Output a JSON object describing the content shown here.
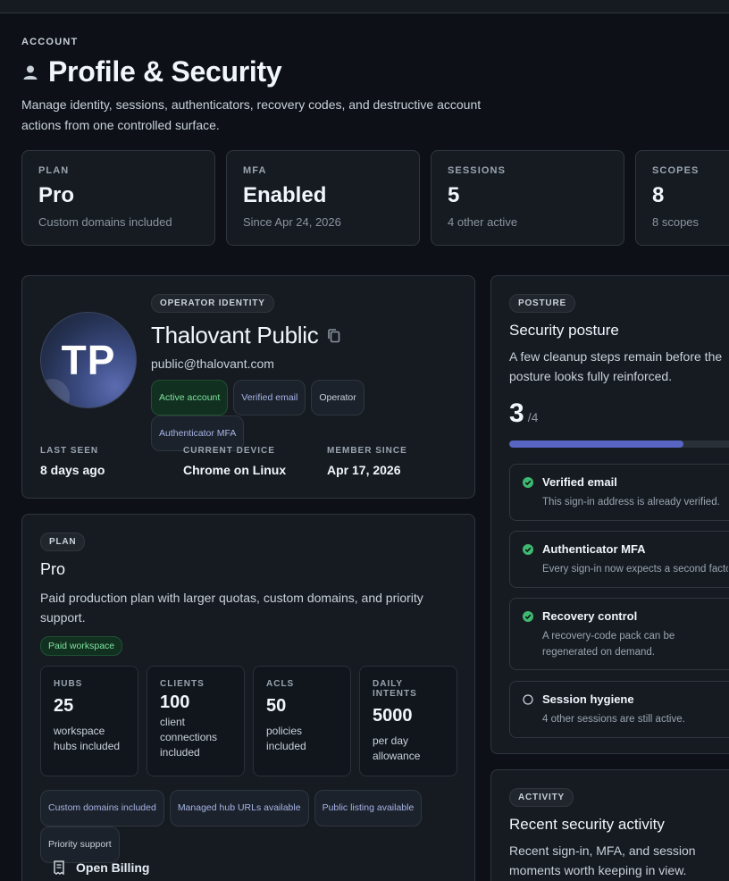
{
  "header": {
    "eyebrow": "ACCOUNT",
    "title": "Profile & Security",
    "description": "Manage identity, sessions, authenticators, recovery codes, and destructive account actions from one controlled surface."
  },
  "stats": [
    {
      "label": "PLAN",
      "value": "Pro",
      "sub": "Custom domains included"
    },
    {
      "label": "MFA",
      "value": "Enabled",
      "sub": "Since Apr 24, 2026"
    },
    {
      "label": "SESSIONS",
      "value": "5",
      "sub": "4 other active"
    },
    {
      "label": "SCOPES",
      "value": "8",
      "sub": "8 scopes"
    }
  ],
  "identity": {
    "chip": "OPERATOR IDENTITY",
    "initials": "TP",
    "name": "Thalovant Public",
    "email": "public@thalovant.com",
    "tags": [
      "Active account",
      "Verified email",
      "Operator",
      "Authenticator MFA"
    ],
    "meta": [
      {
        "label": "LAST SEEN",
        "value": "8 days ago"
      },
      {
        "label": "CURRENT DEVICE",
        "value": "Chrome on Linux"
      },
      {
        "label": "MEMBER SINCE",
        "value": "Apr 17, 2026"
      }
    ]
  },
  "plan": {
    "chip": "PLAN",
    "title": "Pro",
    "description": "Paid production plan with larger quotas, custom domains, and priority support.",
    "badge": "Paid workspace",
    "quotas": [
      {
        "label": "HUBS",
        "value": "25",
        "sub": "workspace hubs included"
      },
      {
        "label": "CLIENTS",
        "value": "100",
        "sub": "client connections included"
      },
      {
        "label": "ACLS",
        "value": "50",
        "sub": "policies included"
      },
      {
        "label": "DAILY INTENTS",
        "value": "5000",
        "sub": "per day allowance"
      }
    ],
    "features": [
      "Custom domains included",
      "Managed hub URLs available",
      "Public listing available",
      "Priority support"
    ],
    "billing_label": "Open Billing"
  },
  "posture": {
    "chip": "POSTURE",
    "title": "Security posture",
    "description": "A few cleanup steps remain before the posture looks fully reinforced.",
    "score": "3",
    "score_total": "/4",
    "progress_fraction": 0.75,
    "checks": [
      {
        "title": "Verified email",
        "desc": "This sign-in address is already verified.",
        "done": true
      },
      {
        "title": "Authenticator MFA",
        "desc": "Every sign-in now expects a second factor.",
        "done": true
      },
      {
        "title": "Recovery control",
        "desc": "A recovery-code pack can be regenerated on demand.",
        "done": true
      },
      {
        "title": "Session hygiene",
        "desc": "4 other sessions are still active.",
        "done": false
      }
    ]
  },
  "activity": {
    "chip": "ACTIVITY",
    "title": "Recent security activity",
    "description": "Recent sign-in, MFA, and session moments worth keeping in view."
  },
  "colors": {
    "background": "#0d1117",
    "card": "#161b22",
    "accent": "#5865c2",
    "success": "#7ee2a0"
  }
}
